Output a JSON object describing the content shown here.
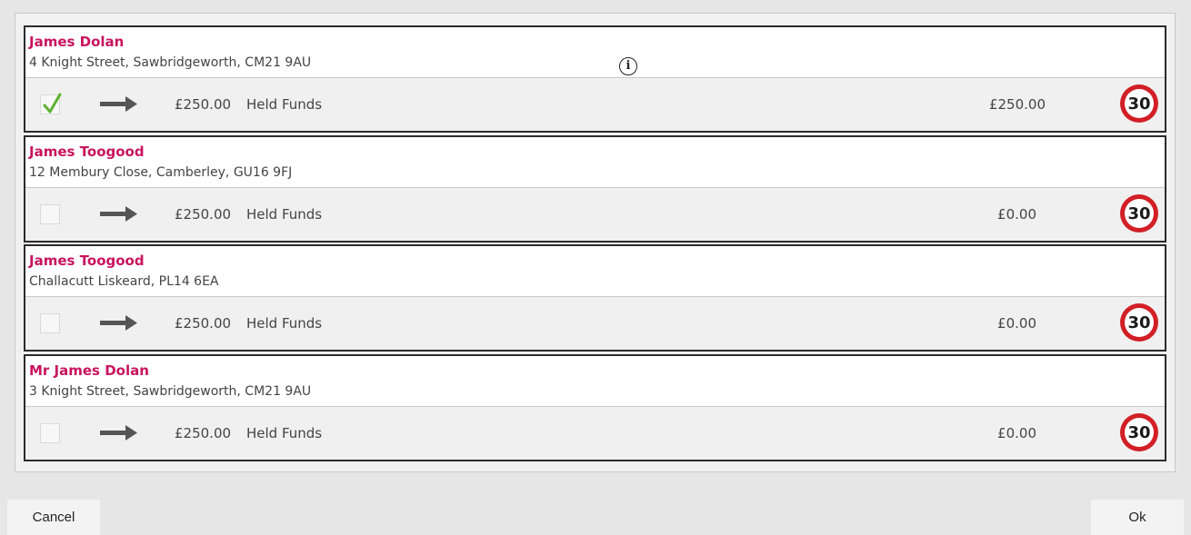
{
  "records": [
    {
      "name": "James Dolan",
      "address": "4 Knight Street, Sawbridgeworth, CM21 9AU",
      "checked": true,
      "amount": "£250.00",
      "description": "Held Funds",
      "value": "£250.00",
      "badge": "30"
    },
    {
      "name": "James Toogood",
      "address": "12 Membury Close, Camberley, GU16 9FJ",
      "checked": false,
      "amount": "£250.00",
      "description": "Held Funds",
      "value": "£0.00",
      "badge": "30"
    },
    {
      "name": "James Toogood",
      "address": "Challacutt Liskeard, PL14 6EA",
      "checked": false,
      "amount": "£250.00",
      "description": "Held Funds",
      "value": "£0.00",
      "badge": "30"
    },
    {
      "name": "Mr James Dolan",
      "address": "3 Knight Street, Sawbridgeworth, CM21 9AU",
      "checked": false,
      "amount": "£250.00",
      "description": "Held Funds",
      "value": "£0.00",
      "badge": "30"
    }
  ],
  "info": {
    "icon": "info-icon",
    "glyph": "i"
  },
  "footer": {
    "cancel_label": "Cancel",
    "ok_label": "Ok"
  },
  "colors": {
    "name": "#c8145e",
    "badge_ring": "#d21f26",
    "check": "#5fb030"
  }
}
